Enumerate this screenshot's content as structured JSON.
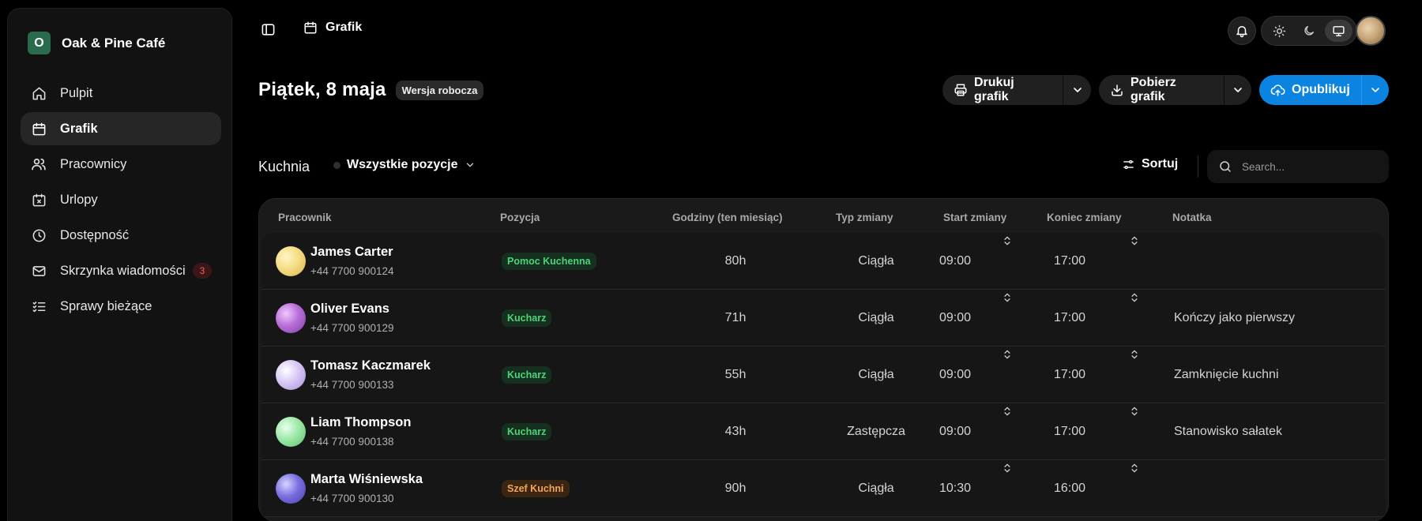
{
  "sidebar": {
    "brand_initial": "O",
    "brand_name": "Oak & Pine Café",
    "items": [
      {
        "label": "Pulpit",
        "icon": "home-icon"
      },
      {
        "label": "Grafik",
        "icon": "calendar-icon",
        "active": true
      },
      {
        "label": "Pracownicy",
        "icon": "users-icon"
      },
      {
        "label": "Urlopy",
        "icon": "calendar-x-icon"
      },
      {
        "label": "Dostępność",
        "icon": "clock-icon"
      },
      {
        "label": "Skrzynka wiadomości",
        "icon": "mail-icon",
        "badge": "3"
      },
      {
        "label": "Sprawy bieżące",
        "icon": "list-checks-icon"
      }
    ]
  },
  "topbar": {
    "breadcrumb": "Grafik"
  },
  "header": {
    "title": "Piątek, 8 maja",
    "status_badge": "Wersja robocza",
    "print_label": "Drukuj grafik",
    "download_label": "Pobierz grafik",
    "publish_label": "Opublikuj"
  },
  "filters": {
    "section": "Kuchnia",
    "position_filter": "Wszystkie pozycje",
    "sort_label": "Sortuj",
    "search_placeholder": "Search..."
  },
  "table": {
    "columns": [
      "Pracownik",
      "Pozycja",
      "Godziny (ten miesiąc)",
      "Typ zmiany",
      "Start zmiany",
      "Koniec zmiany",
      "Notatka"
    ],
    "rows": [
      {
        "name": "James Carter",
        "phone": "+44 7700 900124",
        "role": "Pomoc Kuchenna",
        "hours": "80h",
        "shift_type": "Ciągła",
        "start": "09:00",
        "end": "17:00",
        "note": ""
      },
      {
        "name": "Oliver Evans",
        "phone": "+44 7700 900129",
        "role": "Kucharz",
        "hours": "71h",
        "shift_type": "Ciągła",
        "start": "09:00",
        "end": "17:00",
        "note": "Kończy jako pierwszy"
      },
      {
        "name": "Tomasz Kaczmarek",
        "phone": "+44 7700 900133",
        "role": "Kucharz",
        "hours": "55h",
        "shift_type": "Ciągła",
        "start": "09:00",
        "end": "17:00",
        "note": "Zamknięcie kuchni"
      },
      {
        "name": "Liam Thompson",
        "phone": "+44 7700 900138",
        "role": "Kucharz",
        "hours": "43h",
        "shift_type": "Zastępcza",
        "start": "09:00",
        "end": "17:00",
        "note": "Stanowisko sałatek"
      },
      {
        "name": "Marta Wiśniewska",
        "phone": "+44 7700 900130",
        "role": "Szef Kuchni",
        "hours": "90h",
        "shift_type": "Ciągła",
        "start": "10:30",
        "end": "16:00",
        "note": ""
      }
    ]
  },
  "colors": {
    "accent_blue": "#0a84e0",
    "brand_green": "#2a6b4d",
    "role_green": "#4fd37a",
    "role_orange": "#f2a556",
    "badge_red": "#f06060",
    "avatar_gradients": [
      "#f7e08a",
      "#b86fd8",
      "#d8c8f5",
      "#9ee8a8",
      "#7a6fe0"
    ]
  }
}
